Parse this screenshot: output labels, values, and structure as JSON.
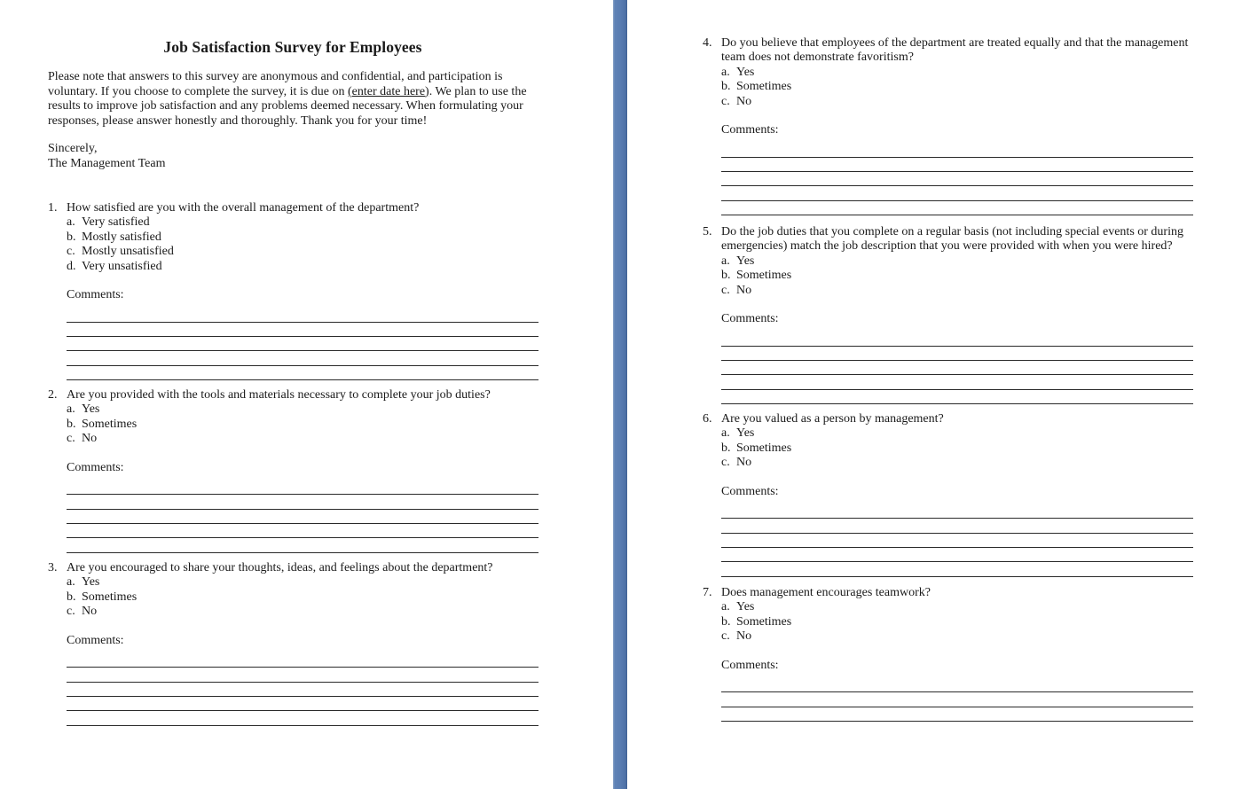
{
  "document": {
    "title": "Job Satisfaction Survey for Employees",
    "intro": {
      "before_link": "Please note that answers to this survey are anonymous and confidential, and participation is voluntary. If you choose to complete the survey, it is due on ",
      "date_placeholder": "(enter date here)",
      "after_link": ". We plan to use the results to improve job satisfaction and any problems deemed necessary. When formulating your responses, please answer honestly and thoroughly. Thank you for your time!"
    },
    "signoff": {
      "closing": "Sincerely,",
      "signature": "The Management Team"
    },
    "comments_label": "Comments:",
    "questions": [
      {
        "number": "1.",
        "text": "How satisfied are you with the overall management of the department?",
        "options": [
          {
            "letter": "a.",
            "label": "Very satisfied"
          },
          {
            "letter": "b.",
            "label": "Mostly satisfied"
          },
          {
            "letter": "c.",
            "label": "Mostly unsatisfied"
          },
          {
            "letter": "d.",
            "label": "Very unsatisfied"
          }
        ],
        "comment_lines": 5
      },
      {
        "number": "2.",
        "text": "Are you provided with the tools and materials necessary to complete your job duties?",
        "options": [
          {
            "letter": "a.",
            "label": "Yes"
          },
          {
            "letter": "b.",
            "label": "Sometimes"
          },
          {
            "letter": "c.",
            "label": "No"
          }
        ],
        "comment_lines": 5
      },
      {
        "number": "3.",
        "text": "Are you encouraged to share your thoughts, ideas, and feelings about the department?",
        "options": [
          {
            "letter": "a.",
            "label": "Yes"
          },
          {
            "letter": "b.",
            "label": "Sometimes"
          },
          {
            "letter": "c.",
            "label": "No"
          }
        ],
        "comment_lines": 5
      },
      {
        "number": "4.",
        "text": "Do you believe that employees of the department are treated equally and that the management team does not demonstrate favoritism?",
        "options": [
          {
            "letter": "a.",
            "label": "Yes"
          },
          {
            "letter": "b.",
            "label": "Sometimes"
          },
          {
            "letter": "c.",
            "label": "No"
          }
        ],
        "comment_lines": 5
      },
      {
        "number": "5.",
        "text": "Do the job duties that you complete on a regular basis (not including special events or during emergencies) match the job description that you were provided with when you were hired?",
        "options": [
          {
            "letter": "a.",
            "label": "Yes"
          },
          {
            "letter": "b.",
            "label": "Sometimes"
          },
          {
            "letter": "c.",
            "label": "No"
          }
        ],
        "comment_lines": 5
      },
      {
        "number": "6.",
        "text": "Are you valued as a person by management?",
        "options": [
          {
            "letter": "a.",
            "label": "Yes"
          },
          {
            "letter": "b.",
            "label": "Sometimes"
          },
          {
            "letter": "c.",
            "label": "No"
          }
        ],
        "comment_lines": 5
      },
      {
        "number": "7.",
        "text": "Does management encourages teamwork?",
        "options": [
          {
            "letter": "a.",
            "label": "Yes"
          },
          {
            "letter": "b.",
            "label": "Sometimes"
          },
          {
            "letter": "c.",
            "label": "No"
          }
        ],
        "comment_lines": 3
      }
    ]
  },
  "colors": {
    "page_background": "#ffffff",
    "page_divider": "#5a7db2",
    "text": "#1a1a1a"
  }
}
